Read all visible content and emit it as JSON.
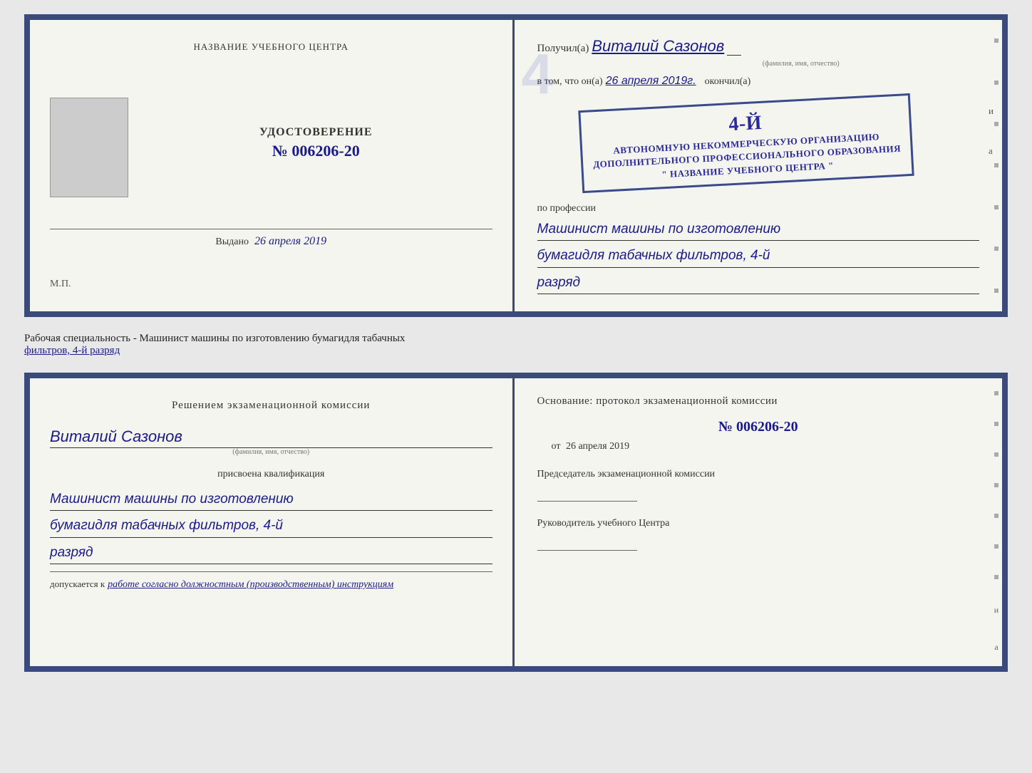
{
  "topDoc": {
    "left": {
      "orgNameHeader": "НАЗВАНИЕ УЧЕБНОГО ЦЕНТРА",
      "certTitle": "УДОСТОВЕРЕНИЕ",
      "certNumber": "№ 006206-20",
      "issuedLabel": "Выдано",
      "issuedDate": "26 апреля 2019",
      "mpLabel": "М.П."
    },
    "right": {
      "receivedLabel": "Получил(а)",
      "recipientName": "Виталий Сазонов",
      "fioLabel": "(фамилия, имя, отчество)",
      "vtomLabel": "в том, что он(а)",
      "vtomDate": "26 апреля 2019г.",
      "okonchilLabel": "окончил(а)",
      "stampLine1": "4-й",
      "stampLine2": "АВТОНОМНУЮ НЕКОММЕРЧЕСКУЮ ОРГАНИЗАЦИЮ",
      "stampLine3": "ДОПОЛНИТЕЛЬНОГО ПРОФЕССИОНАЛЬНОГО ОБРАЗОВАНИЯ",
      "stampLine4": "\" НАЗВАНИЕ УЧЕБНОГО ЦЕНТРА \"",
      "iLabel": "и",
      "aLabel": "а",
      "professionLabel": "по профессии",
      "profession1": "Машинист машины по изготовлению",
      "profession2": "бумагидля табачных фильтров, 4-й",
      "profession3": "разряд"
    }
  },
  "specDescription": {
    "text": "Рабочая специальность - Машинист машины по изготовлению бумагидля табачных",
    "textUnderline": "фильтров, 4-й разряд"
  },
  "bottomDoc": {
    "left": {
      "decisionTitle": "Решением  экзаменационной  комиссии",
      "name": "Виталий Сазонов",
      "fioLabel": "(фамилия, имя, отчество)",
      "qualLabel": "присвоена квалификация",
      "qual1": "Машинист машины по изготовлению",
      "qual2": "бумагидля табачных фильтров, 4-й",
      "qual3": "разряд",
      "dopuskLabel": "допускается к",
      "dopuskValue": "работе согласно должностным (производственным) инструкциям"
    },
    "right": {
      "osnovLabel": "Основание:  протокол  экзаменационной  комиссии",
      "number": "№  006206-20",
      "otLabel": "от",
      "otDate": "26 апреля 2019",
      "chairmanLabel": "Председатель экзаменационной комиссии",
      "rukovLabel": "Руководитель учебного Центра",
      "iLabel": "и",
      "aLabel": "а"
    }
  }
}
